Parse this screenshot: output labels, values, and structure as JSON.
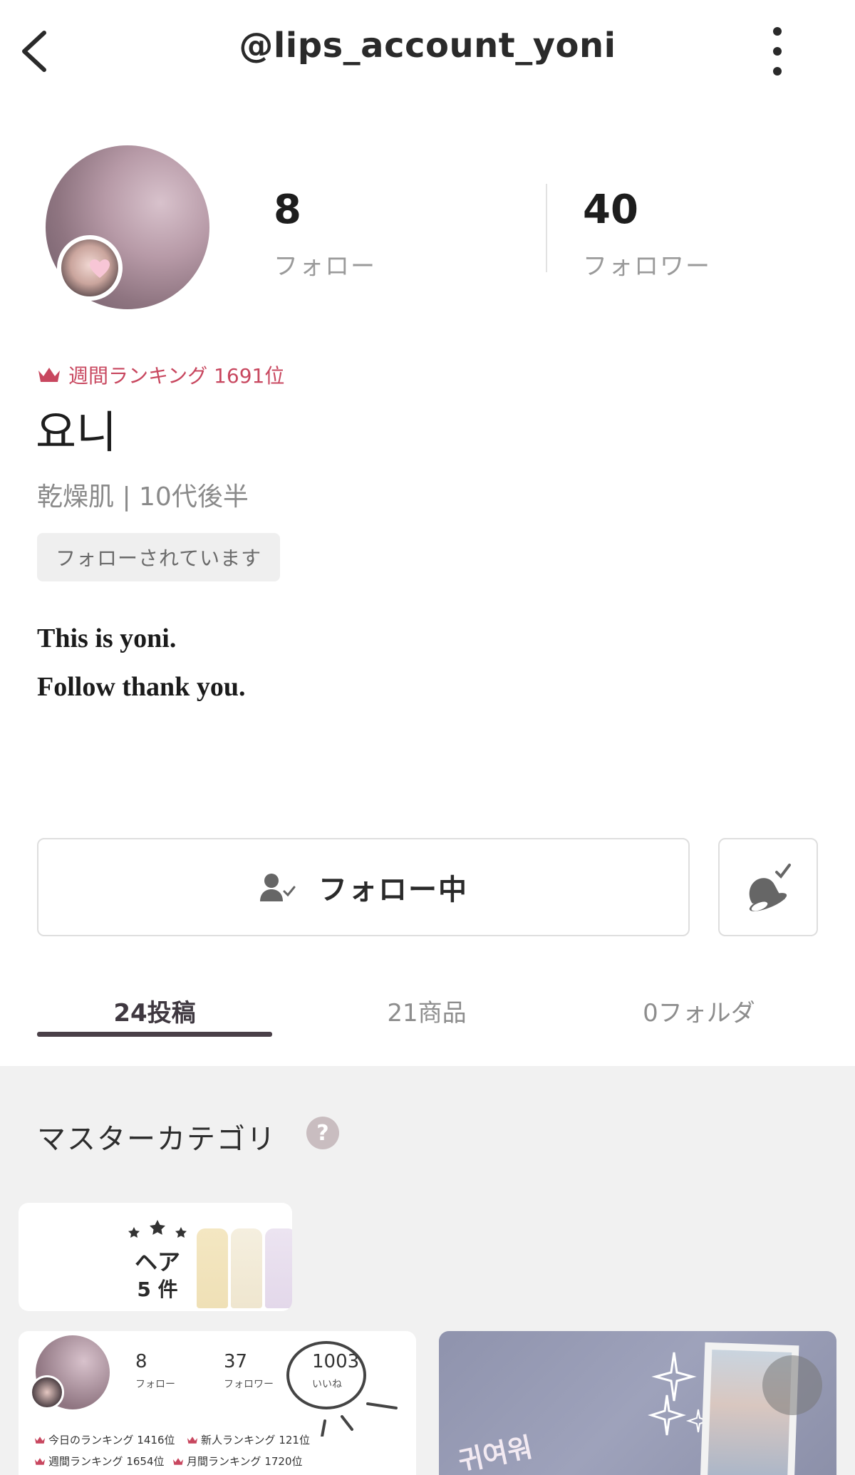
{
  "header": {
    "title": "@lips_account_yoni",
    "back_icon": "chevron-left-icon",
    "more_icon": "vertical-dots-icon"
  },
  "profile": {
    "stats": {
      "follow_count": "8",
      "follow_label": "フォロー",
      "follower_count": "40",
      "follower_label": "フォロワー"
    },
    "ranking": "週間ランキング 1691位",
    "username": "요니",
    "skin_info": "乾燥肌 | 10代後半",
    "followed_badge": "フォローされています",
    "bio": [
      "This is yoni.",
      "Follow thank you."
    ]
  },
  "actions": {
    "follow_label": "フォロー中",
    "bell_icon": "bell-check-icon",
    "follow_icon": "user-check-icon"
  },
  "tabs": [
    {
      "label": "24投稿",
      "active": true
    },
    {
      "label": "21商品",
      "active": false
    },
    {
      "label": "0フォルダ",
      "active": false
    }
  ],
  "master_category": {
    "title": "マスターカテゴリ",
    "help_label": "?",
    "items": [
      {
        "name": "ヘア",
        "count": "5 件"
      }
    ]
  },
  "post_preview": {
    "follow_count": "8",
    "follow_label": "フォロー",
    "follower_count": "37",
    "follower_label": "フォロワー",
    "like_count": "1003",
    "like_label": "いいね",
    "rankings": [
      "今日のランキング 1416位",
      "新人ランキング 121位",
      "週間ランキング 1654位",
      "月間ランキング 1720位"
    ]
  },
  "photo_preview": {
    "korean_text": "귀여워"
  },
  "colors": {
    "accent": "#c8475f",
    "tab_active": "#4a4048",
    "background_lower": "#f1f1f1"
  }
}
